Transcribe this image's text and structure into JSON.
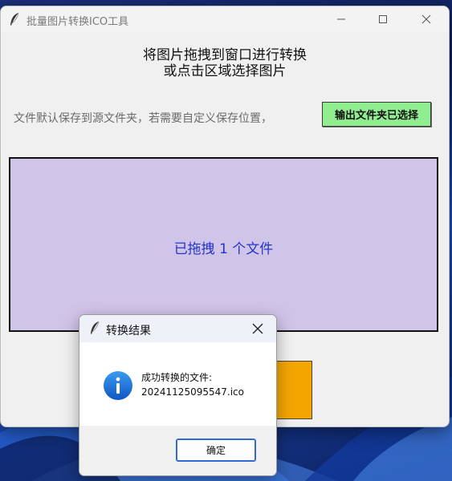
{
  "window": {
    "title": "批量图片转换ICO工具",
    "heading_line1": "将图片拖拽到窗口进行转换",
    "heading_line2": "或点击区域选择图片",
    "hint": "文件默认保存到源文件夹，若需要自定义保存位置，",
    "output_button": "输出文件夹已选择",
    "drop_status": "已拖拽 1 个文件"
  },
  "dialog": {
    "title": "转换结果",
    "message_line1": "成功转换的文件:",
    "message_line2": "20241125095547.ico",
    "ok_button": "确定"
  },
  "colors": {
    "drop_zone": "#d1c4e9",
    "drop_text": "#2434c9",
    "output_button": "#90ee90",
    "convert_button": "#f5a500",
    "info_icon": "#1a6fd6"
  }
}
